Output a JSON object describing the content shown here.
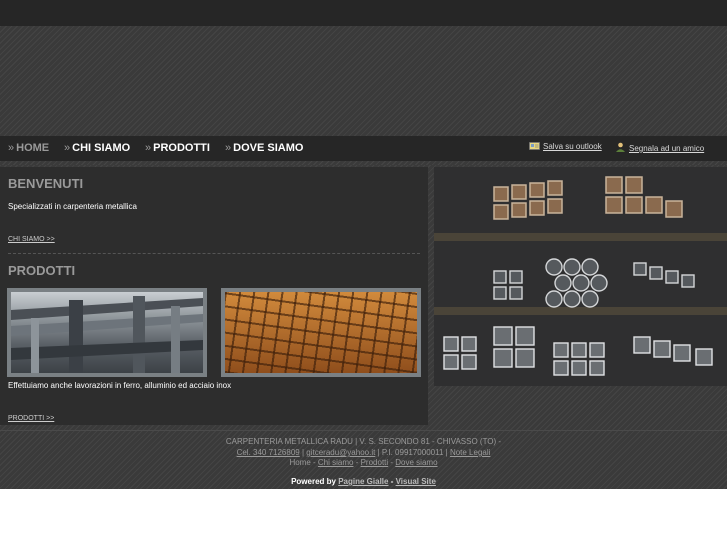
{
  "nav": {
    "items": [
      {
        "label": "HOME",
        "active": true
      },
      {
        "label": "CHI SIAMO",
        "active": false
      },
      {
        "label": "PRODOTTI",
        "active": false
      },
      {
        "label": "DOVE SIAMO",
        "active": false
      }
    ],
    "chevron": "»",
    "utility": {
      "save_outlook": "Salva su outlook",
      "tell_friend": "Segnala ad un amico"
    }
  },
  "welcome": {
    "title": "BENVENUTI",
    "text": "Specializzati in carpenteria metallica",
    "more": "CHI SIAMO >>"
  },
  "products": {
    "title": "PRODOTTI",
    "text": "Effettuiamo anche lavorazioni in ferro, alluminio ed acciaio inox",
    "more": "PRODOTTI >>"
  },
  "footer": {
    "company": "CARPENTERIA METALLICA RADU | V. S. SECONDO 81 - CHIVASSO (TO) -",
    "phone": "Cel. 340 7126809",
    "email": "gitceradu@yahoo.it",
    "vat": "P.I. 09917000011",
    "legal": "Note Legali",
    "links": [
      "Home",
      "Chi siamo",
      "Prodotti",
      "Dove siamo"
    ],
    "separator": " - ",
    "powered_label": "Powered by",
    "powered_a": "Pagine Gialle",
    "powered_b": "Visual Site"
  },
  "colors": {
    "dark": "#262626",
    "panel": "#2d2d2d",
    "pattern": "#3a3a3a",
    "heading": "#9a9a9a"
  }
}
